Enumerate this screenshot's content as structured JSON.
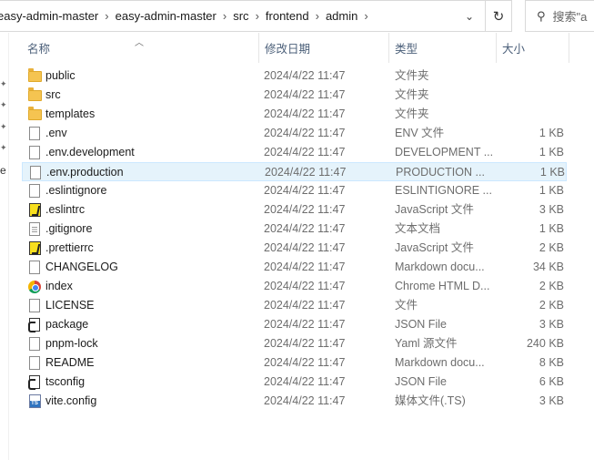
{
  "breadcrumb": [
    {
      "label": "easy-admin-master"
    },
    {
      "label": "easy-admin-master"
    },
    {
      "label": "src"
    },
    {
      "label": "frontend"
    },
    {
      "label": "admin"
    }
  ],
  "search": {
    "placeholder": "搜索\"a"
  },
  "left_nav_cut": "e",
  "columns": {
    "name": "名称",
    "date": "修改日期",
    "type": "类型",
    "size": "大小"
  },
  "files": [
    {
      "icon": "folder-icon",
      "name": "public",
      "date": "2024/4/22 11:47",
      "type": "文件夹",
      "size": ""
    },
    {
      "icon": "folder-icon",
      "name": "src",
      "date": "2024/4/22 11:47",
      "type": "文件夹",
      "size": ""
    },
    {
      "icon": "folder-icon",
      "name": "templates",
      "date": "2024/4/22 11:47",
      "type": "文件夹",
      "size": ""
    },
    {
      "icon": "file-icon",
      "name": ".env",
      "date": "2024/4/22 11:47",
      "type": "ENV 文件",
      "size": "1 KB"
    },
    {
      "icon": "file-icon",
      "name": ".env.development",
      "date": "2024/4/22 11:47",
      "type": "DEVELOPMENT ...",
      "size": "1 KB"
    },
    {
      "icon": "file-icon",
      "name": ".env.production",
      "date": "2024/4/22 11:47",
      "type": "PRODUCTION ...",
      "size": "1 KB"
    },
    {
      "icon": "file-icon",
      "name": ".eslintignore",
      "date": "2024/4/22 11:47",
      "type": "ESLINTIGNORE ...",
      "size": "1 KB"
    },
    {
      "icon": "javascript-icon",
      "name": ".eslintrc",
      "date": "2024/4/22 11:47",
      "type": "JavaScript 文件",
      "size": "3 KB"
    },
    {
      "icon": "text-file-icon",
      "name": ".gitignore",
      "date": "2024/4/22 11:47",
      "type": "文本文档",
      "size": "1 KB"
    },
    {
      "icon": "javascript-icon",
      "name": ".prettierrc",
      "date": "2024/4/22 11:47",
      "type": "JavaScript 文件",
      "size": "2 KB"
    },
    {
      "icon": "file-icon",
      "name": "CHANGELOG",
      "date": "2024/4/22 11:47",
      "type": "Markdown docu...",
      "size": "34 KB"
    },
    {
      "icon": "chrome-icon",
      "name": "index",
      "date": "2024/4/22 11:47",
      "type": "Chrome HTML D...",
      "size": "2 KB"
    },
    {
      "icon": "file-icon",
      "name": "LICENSE",
      "date": "2024/4/22 11:47",
      "type": "文件",
      "size": "2 KB"
    },
    {
      "icon": "json-icon",
      "name": "package",
      "date": "2024/4/22 11:47",
      "type": "JSON File",
      "size": "3 KB"
    },
    {
      "icon": "file-icon",
      "name": "pnpm-lock",
      "date": "2024/4/22 11:47",
      "type": "Yaml 源文件",
      "size": "240 KB"
    },
    {
      "icon": "file-icon",
      "name": "README",
      "date": "2024/4/22 11:47",
      "type": "Markdown docu...",
      "size": "8 KB"
    },
    {
      "icon": "json-icon",
      "name": "tsconfig",
      "date": "2024/4/22 11:47",
      "type": "JSON File",
      "size": "6 KB"
    },
    {
      "icon": "typescript-icon",
      "name": "vite.config",
      "date": "2024/4/22 11:47",
      "type": "媒体文件(.TS)",
      "size": "3 KB"
    }
  ],
  "selected_index": 5
}
